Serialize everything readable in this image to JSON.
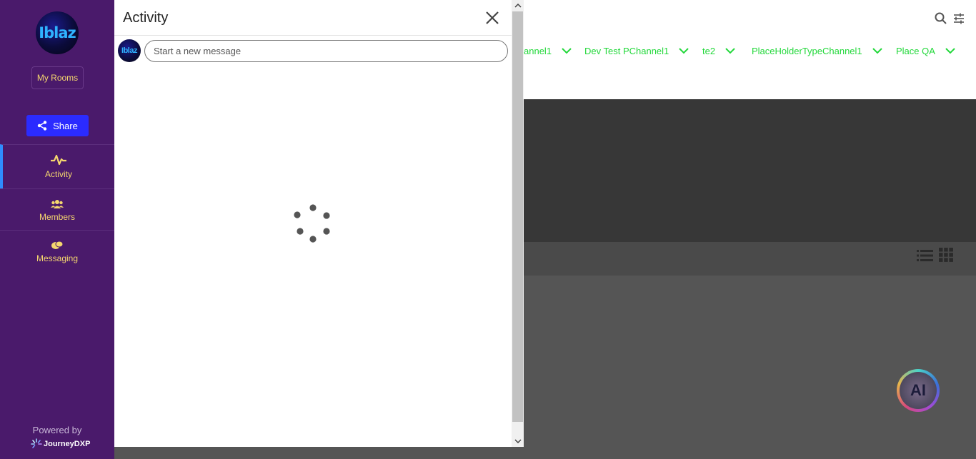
{
  "sidebar": {
    "logo_text": "Iblaz",
    "my_rooms_label": "My Rooms",
    "share_label": "Share",
    "nav": [
      {
        "label": "Activity",
        "icon": "activity-icon",
        "active": true
      },
      {
        "label": "Members",
        "icon": "members-icon",
        "active": false
      },
      {
        "label": "Messaging",
        "icon": "messaging-icon",
        "active": false
      }
    ],
    "powered_by": "Powered by",
    "brand": "JourneyDXP"
  },
  "background": {
    "channels": [
      {
        "label": "annel1"
      },
      {
        "label": "Dev Test PChannel1"
      },
      {
        "label": "te2"
      },
      {
        "label": "PlaceHolderTypeChannel1"
      },
      {
        "label": "Place QA"
      }
    ],
    "ai_label": "AI"
  },
  "panel": {
    "title": "Activity",
    "avatar_text": "Iblaz",
    "message_placeholder": "Start a new message",
    "loading": true
  },
  "colors": {
    "sidebar_bg": "#4a1a6b",
    "sidebar_text": "#f5d76e",
    "share_bg": "#2b2bff",
    "channel_text": "#22d83a",
    "active_indicator": "#2f8cff"
  }
}
